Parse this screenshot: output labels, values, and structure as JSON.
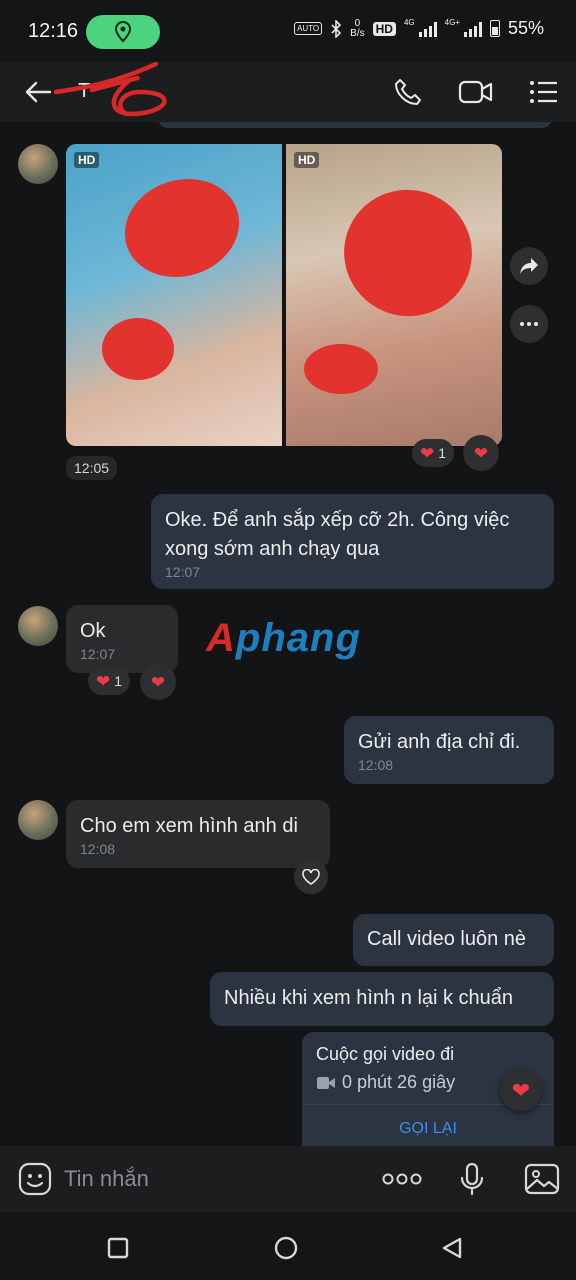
{
  "status_bar": {
    "time": "12:16",
    "auto_badge": "AUTO",
    "net_rate_value": "0",
    "net_rate_unit": "B/s",
    "hd_badge": "HD",
    "net1": "4G",
    "net2": "4G+",
    "battery": "55%"
  },
  "header": {
    "contact_name": "T"
  },
  "messages": {
    "photo_hd_1": "HD",
    "photo_hd_2": "HD",
    "photo_time": "12:05",
    "photo_reaction_count": "1",
    "msg1_text": "Oke. Để anh sắp xếp cỡ 2h. Công việc xong sớm anh chạy qua",
    "msg1_time": "12:07",
    "msg2_text": "Ok",
    "msg2_time": "12:07",
    "msg2_reaction_count": "1",
    "msg3_text": "Gửi anh địa chỉ đi.",
    "msg3_time": "12:08",
    "msg4_text": "Cho em xem hình anh di",
    "msg4_time": "12:08",
    "msg5_text": "Call video luôn nè",
    "msg6_text": "Nhiều khi xem hình n lại k chuẩn",
    "call_title": "Cuộc gọi video đi",
    "call_duration": "0 phút 26 giây",
    "call_back": "GỌI LẠI"
  },
  "watermark": "Aphang",
  "input": {
    "placeholder": "Tin nhắn"
  },
  "colors": {
    "accent_blue": "#3b8df0",
    "heart_red": "#ec3b47",
    "location_green": "#4cd37e"
  },
  "icons": [
    "arrow-left-icon",
    "phone-icon",
    "video-camera-icon",
    "menu-list-icon",
    "share-icon",
    "more-icon",
    "heart-icon",
    "sticker-icon",
    "more-dots-icon",
    "microphone-icon",
    "image-icon",
    "nav-recents-icon",
    "nav-home-icon",
    "nav-back-icon"
  ]
}
